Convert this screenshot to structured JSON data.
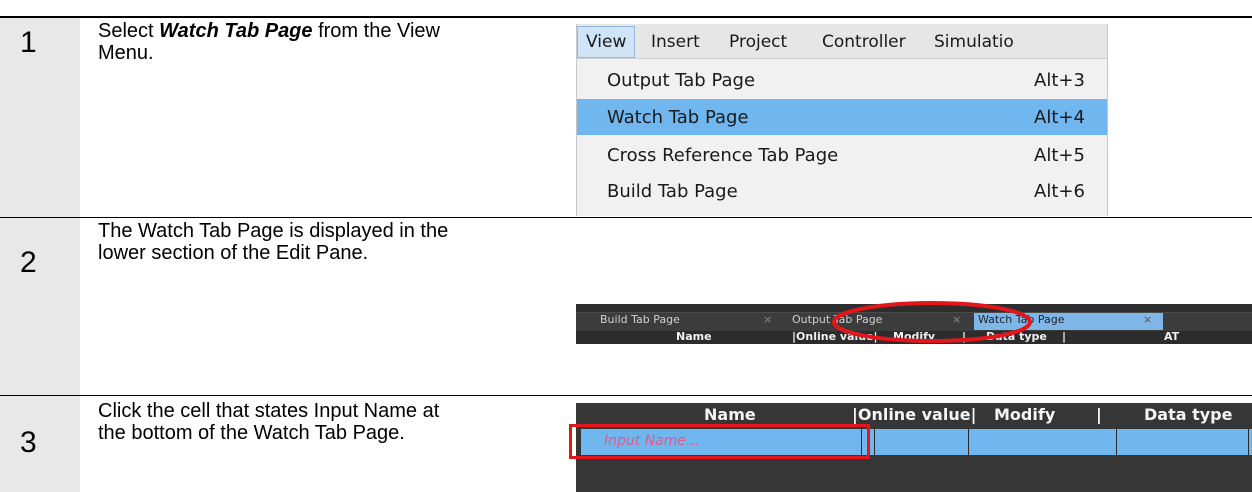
{
  "steps": [
    {
      "number": "1",
      "text_before": "Select ",
      "text_bold": "Watch Tab Page",
      "text_after": " from the View Menu."
    },
    {
      "number": "2",
      "text": "The Watch Tab Page is displayed in the lower section of the Edit Pane."
    },
    {
      "number": "3",
      "text": "Click the cell that states Input Name at the bottom of the Watch Tab Page."
    }
  ],
  "menu": {
    "bar": [
      "View",
      "Insert",
      "Project",
      "Controller",
      "Simulatio"
    ],
    "items": [
      {
        "label": "Output Tab Page",
        "shortcut": "Alt+3"
      },
      {
        "label": "Watch Tab Page",
        "shortcut": "Alt+4",
        "selected": true
      },
      {
        "label": "Cross Reference Tab Page",
        "shortcut": "Alt+5"
      },
      {
        "label": "Build Tab Page",
        "shortcut": "Alt+6"
      }
    ]
  },
  "tabstrip": {
    "tabs": [
      "Build Tab Page",
      "Output Tab Page",
      "Watch Tab Page"
    ],
    "close": "×",
    "headers": [
      "Name",
      "|Online value|",
      "Modify",
      "|",
      "Data type",
      "|",
      "AT"
    ]
  },
  "grid": {
    "headers": [
      "Name",
      "|Online value|",
      "Modify",
      "|",
      "Data type"
    ],
    "input_placeholder": "Input Name..."
  },
  "colors": {
    "selection": "#6fb7ee",
    "highlight_red": "#e4161b",
    "number_column": "#e8e8e8"
  }
}
